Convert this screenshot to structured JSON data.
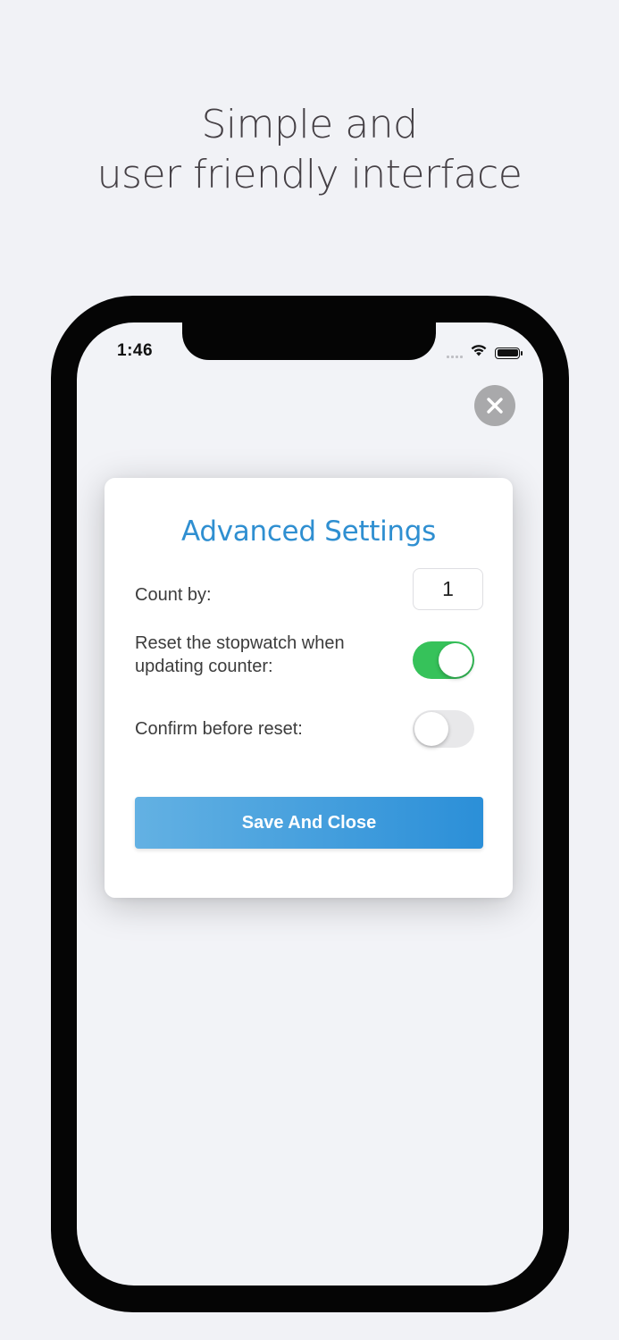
{
  "headline": {
    "line1": "Simple and",
    "line2": "user friendly interface"
  },
  "status_bar": {
    "time": "1:46",
    "icons": [
      "signal-dots-icon",
      "wifi-icon",
      "battery-icon"
    ]
  },
  "close_button": {
    "icon": "close-icon"
  },
  "settings": {
    "title": "Advanced Settings",
    "count_by_label": "Count by:",
    "count_by_value": "1",
    "reset_label": "Reset the stopwatch when updating counter:",
    "reset_enabled": true,
    "confirm_label": "Confirm before reset:",
    "confirm_enabled": false,
    "save_label": "Save And Close"
  },
  "colors": {
    "background": "#f1f2f6",
    "title_blue": "#2f8fd1",
    "toggle_green": "#36c25a",
    "button_gradient_start": "#63b1e3",
    "button_gradient_end": "#2b8fd8"
  }
}
